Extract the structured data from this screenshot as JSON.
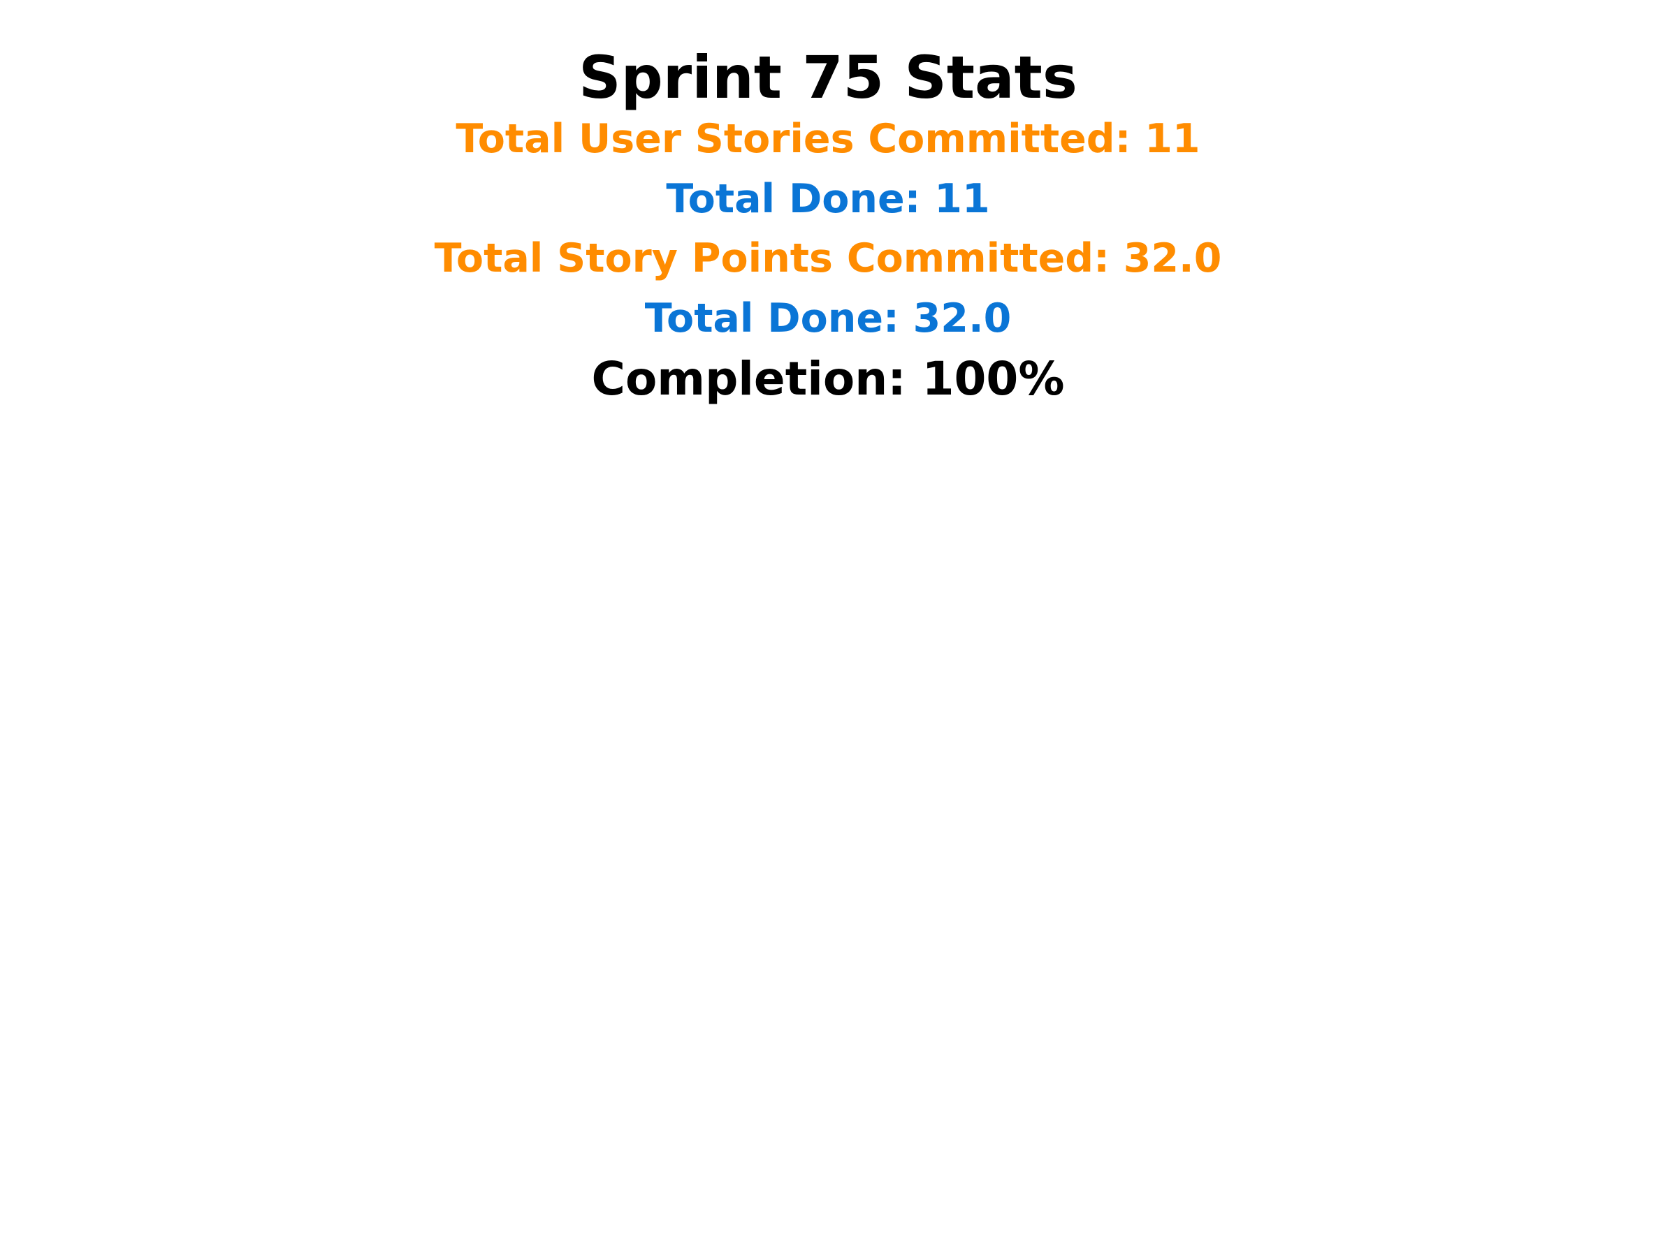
{
  "colors": {
    "title": "#000000",
    "committed": "#ff8c00",
    "done": "#0a75d6",
    "completion": "#000000",
    "background": "#ffffff"
  },
  "report": {
    "title": "Sprint 75 Stats",
    "stories_committed": "Total User Stories Committed: 11",
    "stories_done": "Total Done: 11",
    "points_committed": "Total Story Points Committed: 32.0",
    "points_done": "Total Done: 32.0",
    "completion": "Completion: 100%"
  }
}
